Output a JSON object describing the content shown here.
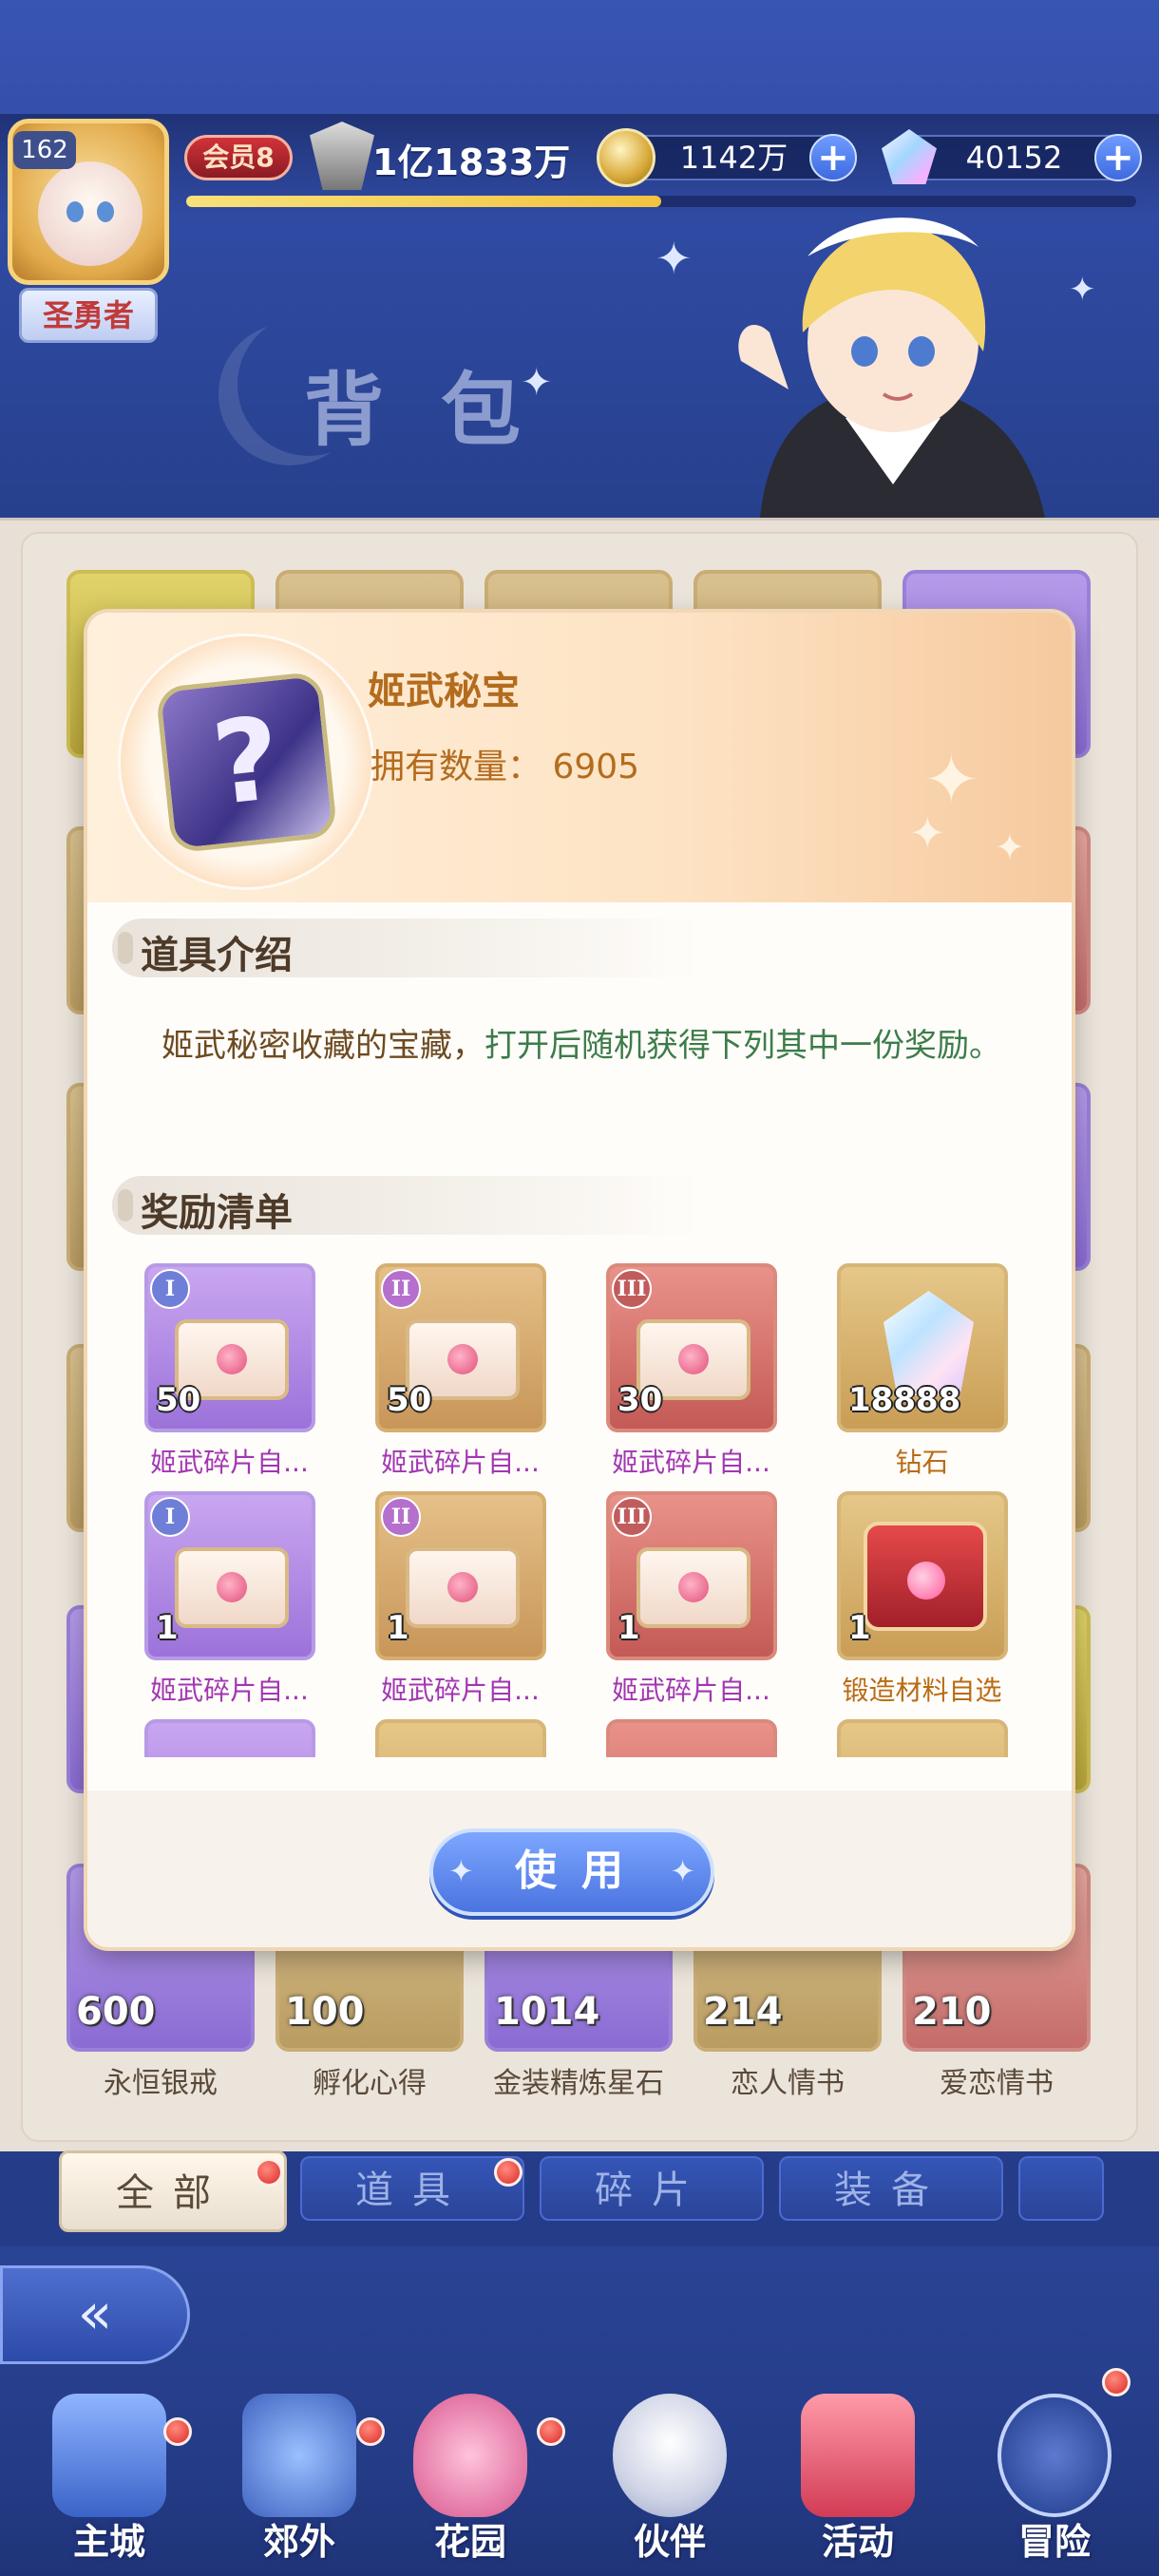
{
  "hud": {
    "avatar_level": "162",
    "player_title": "圣勇者",
    "vip_label": "会员8",
    "power": "1亿1833万",
    "gold": "1142万",
    "gems": "40152",
    "plus_symbol": "+",
    "exp_fraction": 0.5
  },
  "page": {
    "title": "背包"
  },
  "bag": {
    "bottom_row": [
      {
        "count": "600",
        "name": "永恒银戒"
      },
      {
        "count": "100",
        "name": "孵化心得"
      },
      {
        "count": "1014",
        "name": "金装精炼星石"
      },
      {
        "count": "214",
        "name": "恋人情书"
      },
      {
        "count": "210",
        "name": "爱恋情书"
      }
    ]
  },
  "tabs": [
    {
      "label": "全部",
      "active": true
    },
    {
      "label": "道具",
      "active": false
    },
    {
      "label": "碎片",
      "active": false
    },
    {
      "label": "装备",
      "active": false
    }
  ],
  "nav": [
    {
      "label": "主城"
    },
    {
      "label": "郊外"
    },
    {
      "label": "花园"
    },
    {
      "label": "伙伴"
    },
    {
      "label": "活动"
    },
    {
      "label": "冒险"
    }
  ],
  "modal": {
    "item_name": "姬武秘宝",
    "quantity_label": "拥有数量：",
    "quantity_value": "6905",
    "intro_header": "道具介绍",
    "description_part1": "姬武秘密收藏的宝藏，",
    "description_part2": "打开后随机获得下列其中一份奖励。",
    "rewards_header": "奖励清单",
    "rewards": [
      {
        "tier": "I",
        "count": "50",
        "name": "姬武碎片自...",
        "style": "purple",
        "kind": "chest"
      },
      {
        "tier": "II",
        "count": "50",
        "name": "姬武碎片自...",
        "style": "orange",
        "kind": "chest"
      },
      {
        "tier": "III",
        "count": "30",
        "name": "姬武碎片自...",
        "style": "red",
        "kind": "chest"
      },
      {
        "tier": "",
        "count": "18888",
        "name": "钻石",
        "style": "gold",
        "kind": "diamond"
      },
      {
        "tier": "I",
        "count": "1",
        "name": "姬武碎片自...",
        "style": "purple",
        "kind": "chest"
      },
      {
        "tier": "II",
        "count": "1",
        "name": "姬武碎片自...",
        "style": "orange",
        "kind": "chest"
      },
      {
        "tier": "III",
        "count": "1",
        "name": "姬武碎片自...",
        "style": "red",
        "kind": "chest"
      },
      {
        "tier": "",
        "count": "1",
        "name": "锻造材料自选",
        "style": "gold",
        "kind": "forge"
      }
    ],
    "use_button_label": "使用"
  },
  "icons": {
    "avatar": "avatar-portrait",
    "power": "power-crest-icon",
    "gold": "gold-coin-icon",
    "gem": "diamond-icon",
    "back": "back-arrow-icon",
    "sparkle": "sparkle-icon"
  },
  "colors": {
    "accent_blue": "#4b74e0",
    "title_orange": "#b36c1e",
    "reward_violet": "#a236b2",
    "reward_amber": "#b96b14",
    "notification_red": "#dd2a2a"
  }
}
